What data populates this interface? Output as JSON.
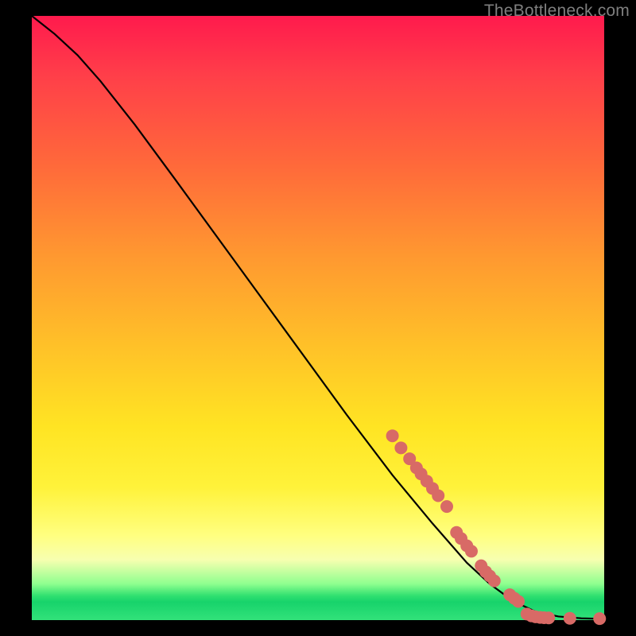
{
  "watermark": "TheBottleneck.com",
  "colors": {
    "background": "#000000",
    "curve_stroke": "#000000",
    "marker_fill": "#d86a66",
    "gradient_top": "#ff1a4d",
    "gradient_bottom": "#17d36b"
  },
  "chart_data": {
    "type": "line",
    "title": "",
    "xlabel": "",
    "ylabel": "",
    "xlim": [
      0,
      100
    ],
    "ylim": [
      0,
      100
    ],
    "grid": false,
    "legend": false,
    "curve": [
      {
        "x": 0,
        "y": 100
      },
      {
        "x": 4,
        "y": 97
      },
      {
        "x": 8,
        "y": 93.5
      },
      {
        "x": 12,
        "y": 89.2
      },
      {
        "x": 18,
        "y": 82
      },
      {
        "x": 25,
        "y": 73
      },
      {
        "x": 35,
        "y": 60
      },
      {
        "x": 45,
        "y": 47
      },
      {
        "x": 55,
        "y": 34
      },
      {
        "x": 63,
        "y": 24
      },
      {
        "x": 70,
        "y": 16
      },
      {
        "x": 76,
        "y": 9.5
      },
      {
        "x": 80,
        "y": 6
      },
      {
        "x": 84,
        "y": 3.2
      },
      {
        "x": 88,
        "y": 1.4
      },
      {
        "x": 92,
        "y": 0.6
      },
      {
        "x": 96,
        "y": 0.3
      },
      {
        "x": 100,
        "y": 0.2
      }
    ],
    "markers": [
      {
        "x": 63,
        "y": 30.5
      },
      {
        "x": 64.5,
        "y": 28.5
      },
      {
        "x": 66,
        "y": 26.7
      },
      {
        "x": 67.2,
        "y": 25.2
      },
      {
        "x": 68,
        "y": 24.2
      },
      {
        "x": 69,
        "y": 23
      },
      {
        "x": 70,
        "y": 21.8
      },
      {
        "x": 71,
        "y": 20.6
      },
      {
        "x": 72.5,
        "y": 18.8
      },
      {
        "x": 74.2,
        "y": 14.5
      },
      {
        "x": 75,
        "y": 13.5
      },
      {
        "x": 76,
        "y": 12.3
      },
      {
        "x": 76.8,
        "y": 11.4
      },
      {
        "x": 78.5,
        "y": 9
      },
      {
        "x": 79.3,
        "y": 8
      },
      {
        "x": 80,
        "y": 7.3
      },
      {
        "x": 80.8,
        "y": 6.5
      },
      {
        "x": 83.5,
        "y": 4.2
      },
      {
        "x": 84.3,
        "y": 3.6
      },
      {
        "x": 85,
        "y": 3.1
      },
      {
        "x": 86.5,
        "y": 1.0
      },
      {
        "x": 87.3,
        "y": 0.7
      },
      {
        "x": 88,
        "y": 0.55
      },
      {
        "x": 88.8,
        "y": 0.45
      },
      {
        "x": 89.5,
        "y": 0.4
      },
      {
        "x": 90.3,
        "y": 0.36
      },
      {
        "x": 94,
        "y": 0.3
      },
      {
        "x": 99.2,
        "y": 0.25
      }
    ]
  }
}
